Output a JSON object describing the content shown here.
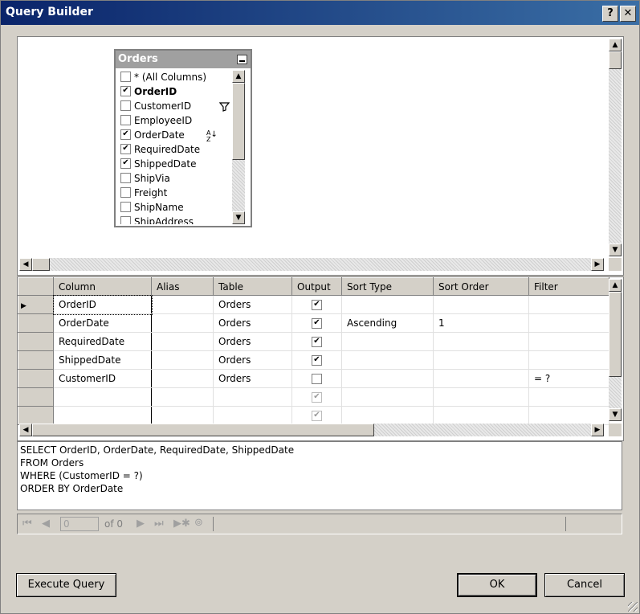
{
  "window": {
    "title": "Query Builder",
    "help_button": "?",
    "close_button": "✕"
  },
  "diagram": {
    "table_name": "Orders",
    "columns": [
      {
        "label": "* (All Columns)",
        "checked": false,
        "bold": false,
        "icon": ""
      },
      {
        "label": "OrderID",
        "checked": true,
        "bold": true,
        "icon": ""
      },
      {
        "label": "CustomerID",
        "checked": false,
        "bold": false,
        "icon": "filter-icon"
      },
      {
        "label": "EmployeeID",
        "checked": false,
        "bold": false,
        "icon": ""
      },
      {
        "label": "OrderDate",
        "checked": true,
        "bold": false,
        "icon": "sort-ascending-icon"
      },
      {
        "label": "RequiredDate",
        "checked": true,
        "bold": false,
        "icon": ""
      },
      {
        "label": "ShippedDate",
        "checked": true,
        "bold": false,
        "icon": ""
      },
      {
        "label": "ShipVia",
        "checked": false,
        "bold": false,
        "icon": ""
      },
      {
        "label": "Freight",
        "checked": false,
        "bold": false,
        "icon": ""
      },
      {
        "label": "ShipName",
        "checked": false,
        "bold": false,
        "icon": ""
      },
      {
        "label": "ShipAddress",
        "checked": false,
        "bold": false,
        "icon": ""
      }
    ]
  },
  "grid": {
    "headers": [
      "Column",
      "Alias",
      "Table",
      "Output",
      "Sort Type",
      "Sort Order",
      "Filter"
    ],
    "rows": [
      {
        "column": "OrderID",
        "alias": "",
        "table": "Orders",
        "output": true,
        "sort_type": "",
        "sort_order": "",
        "filter": "",
        "current": true
      },
      {
        "column": "OrderDate",
        "alias": "",
        "table": "Orders",
        "output": true,
        "sort_type": "Ascending",
        "sort_order": "1",
        "filter": "",
        "current": false
      },
      {
        "column": "RequiredDate",
        "alias": "",
        "table": "Orders",
        "output": true,
        "sort_type": "",
        "sort_order": "",
        "filter": "",
        "current": false
      },
      {
        "column": "ShippedDate",
        "alias": "",
        "table": "Orders",
        "output": true,
        "sort_type": "",
        "sort_order": "",
        "filter": "",
        "current": false
      },
      {
        "column": "CustomerID",
        "alias": "",
        "table": "Orders",
        "output": false,
        "sort_type": "",
        "sort_order": "",
        "filter": "= ?",
        "current": false
      },
      {
        "column": "",
        "alias": "",
        "table": "",
        "output": "gray",
        "sort_type": "",
        "sort_order": "",
        "filter": "",
        "current": false
      },
      {
        "column": "",
        "alias": "",
        "table": "",
        "output": "gray",
        "sort_type": "",
        "sort_order": "",
        "filter": "",
        "current": false
      }
    ]
  },
  "sql": {
    "lines": [
      "SELECT OrderID, OrderDate, RequiredDate, ShippedDate",
      "FROM  Orders",
      "WHERE (CustomerID = ?)",
      "ORDER BY OrderDate"
    ]
  },
  "navigator": {
    "position_value": "0",
    "of_label": "of 0"
  },
  "buttons": {
    "execute": "Execute Query",
    "ok": "OK",
    "cancel": "Cancel"
  }
}
